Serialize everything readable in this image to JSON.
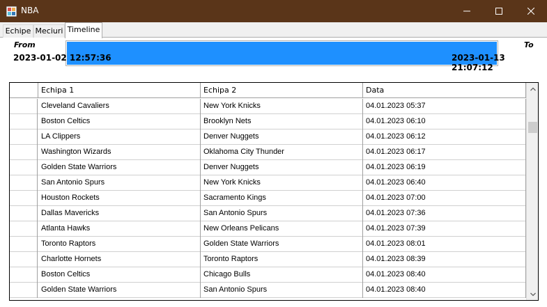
{
  "window": {
    "title": "NBA"
  },
  "tabs": [
    {
      "label": "Echipe",
      "active": false
    },
    {
      "label": "Meciuri",
      "active": false
    },
    {
      "label": "Timeline",
      "active": true
    }
  ],
  "timeline": {
    "from_label": "From",
    "to_label": "To",
    "from_value": "2023-01-02 12:57:36",
    "to_value": "2023-01-13 21:07:12",
    "fill_fraction": 1.0,
    "fill_color": "#1e90ff"
  },
  "grid": {
    "columns": [
      "Echipa 1",
      "Echipa 2",
      "Data"
    ],
    "rows": [
      [
        "Cleveland Cavaliers",
        "New York Knicks",
        "04.01.2023 05:37"
      ],
      [
        "Boston Celtics",
        "Brooklyn Nets",
        "04.01.2023 06:10"
      ],
      [
        "LA Clippers",
        "Denver Nuggets",
        "04.01.2023 06:12"
      ],
      [
        "Washington Wizards",
        "Oklahoma City Thunder",
        "04.01.2023 06:17"
      ],
      [
        "Golden State Warriors",
        "Denver Nuggets",
        "04.01.2023 06:19"
      ],
      [
        "San Antonio Spurs",
        "New York Knicks",
        "04.01.2023 06:40"
      ],
      [
        "Houston Rockets",
        "Sacramento Kings",
        "04.01.2023 07:00"
      ],
      [
        "Dallas Mavericks",
        "San Antonio Spurs",
        "04.01.2023 07:36"
      ],
      [
        "Atlanta Hawks",
        "New Orleans Pelicans",
        "04.01.2023 07:39"
      ],
      [
        "Toronto Raptors",
        "Golden State Warriors",
        "04.01.2023 08:01"
      ],
      [
        "Charlotte Hornets",
        "Toronto Raptors",
        "04.01.2023 08:39"
      ],
      [
        "Boston Celtics",
        "Chicago Bulls",
        "04.01.2023 08:40"
      ],
      [
        "Golden State Warriors",
        "San Antonio Spurs",
        "04.01.2023 08:40"
      ]
    ]
  },
  "colors": {
    "titlebar": "#5a3519",
    "accent": "#1e90ff"
  }
}
